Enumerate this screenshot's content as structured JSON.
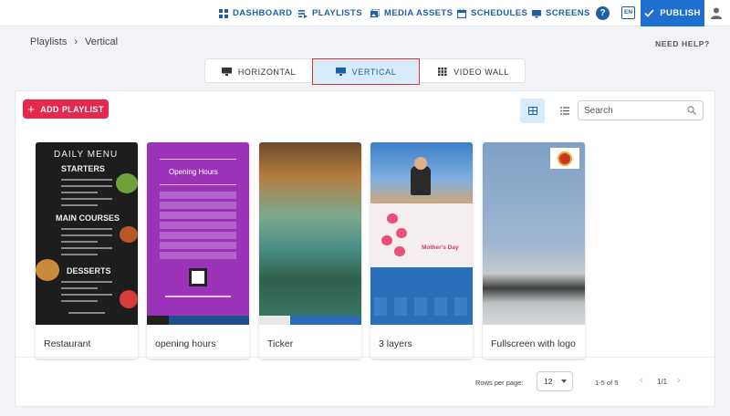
{
  "nav": {
    "items": [
      {
        "label": "DASHBOARD",
        "icon": "dashboard-icon"
      },
      {
        "label": "PLAYLISTS",
        "icon": "playlists-icon"
      },
      {
        "label": "MEDIA ASSETS",
        "icon": "media-assets-icon"
      },
      {
        "label": "SCHEDULES",
        "icon": "calendar-icon"
      },
      {
        "label": "SCREENS",
        "icon": "monitor-icon"
      }
    ],
    "help_symbol": "?",
    "language": "EN",
    "publish_label": "PUBLISH",
    "accent_color": "#1e6fd0"
  },
  "breadcrumb": {
    "root": "Playlists",
    "separator": "›",
    "current": "Vertical"
  },
  "need_help": "NEED HELP?",
  "tabs": [
    {
      "label": "HORIZONTAL",
      "icon": "monitor-horizontal-icon",
      "active": false
    },
    {
      "label": "VERTICAL",
      "icon": "monitor-vertical-icon",
      "active": true
    },
    {
      "label": "VIDEO WALL",
      "icon": "video-wall-icon",
      "active": false
    }
  ],
  "toolbar": {
    "add_label": "ADD PLAYLIST",
    "add_color": "#e6284f",
    "search_placeholder": "Search"
  },
  "playlists": [
    {
      "name": "Restaurant"
    },
    {
      "name": "opening hours"
    },
    {
      "name": "Ticker"
    },
    {
      "name": "3 layers"
    },
    {
      "name": "Fullscreen with logo"
    }
  ],
  "thumbs": {
    "menu": {
      "title": "DAILY MENU",
      "sections": [
        "STARTERS",
        "MAIN COURSES",
        "DESSERTS"
      ]
    },
    "hours": {
      "title": "Opening Hours"
    },
    "layers": {
      "banner": "Mother's Day"
    }
  },
  "pagination": {
    "rows_label": "Rows per page:",
    "rows_value": "12",
    "range": "1-5 of 5",
    "page": "1/1",
    "prev": "‹",
    "next": "›"
  }
}
